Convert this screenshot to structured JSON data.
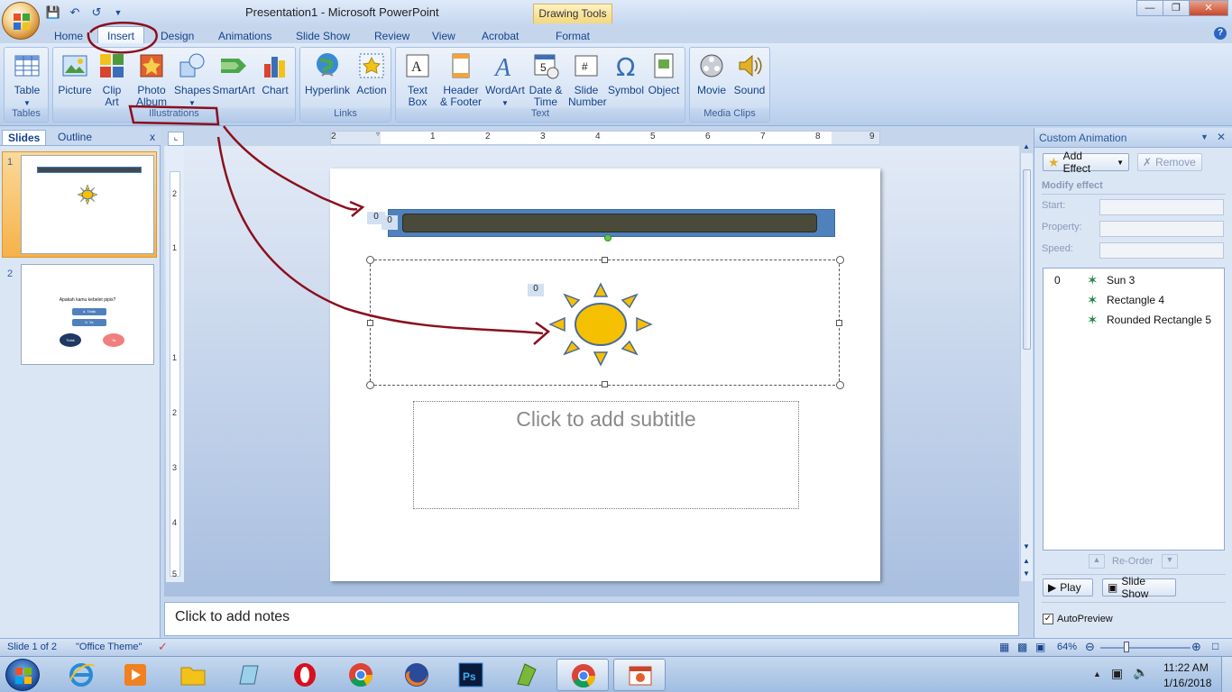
{
  "window": {
    "title": "Presentation1 - Microsoft PowerPoint",
    "contextual_tab_group": "Drawing Tools"
  },
  "ribbon_tabs": [
    "Home",
    "Insert",
    "Design",
    "Animations",
    "Slide Show",
    "Review",
    "View",
    "Acrobat",
    "Format"
  ],
  "active_tab": "Insert",
  "ribbon_groups": {
    "tables": {
      "label": "Tables",
      "buttons": [
        "Table"
      ]
    },
    "illustrations": {
      "label": "Illustrations",
      "buttons": [
        "Picture",
        "Clip Art",
        "Photo Album",
        "Shapes",
        "SmartArt",
        "Chart"
      ]
    },
    "links": {
      "label": "Links",
      "buttons": [
        "Hyperlink",
        "Action"
      ]
    },
    "text": {
      "label": "Text",
      "buttons": [
        "Text Box",
        "Header & Footer",
        "WordArt",
        "Date & Time",
        "Slide Number",
        "Symbol",
        "Object"
      ]
    },
    "media": {
      "label": "Media Clips",
      "buttons": [
        "Movie",
        "Sound"
      ]
    }
  },
  "left_pane": {
    "tabs": [
      "Slides",
      "Outline"
    ],
    "close": "x",
    "slides": [
      {
        "number": "1"
      },
      {
        "number": "2",
        "question": "Apakah kamu kebelet pipis?",
        "option_a": "a. Tidak",
        "option_b": "b. Ya",
        "oval_left": "Tidak",
        "oval_right": "Ya"
      }
    ]
  },
  "ruler": {
    "top_marks": [
      "2",
      "1",
      "1",
      "2",
      "3",
      "4",
      "5",
      "6",
      "7",
      "8",
      "9"
    ],
    "left_marks": [
      "2",
      "1",
      "1",
      "2",
      "3",
      "4",
      "5"
    ]
  },
  "slide": {
    "subtitle_placeholder": "Click to add subtitle",
    "tags": [
      "0",
      "0",
      "0"
    ]
  },
  "notes_placeholder": "Click to add notes",
  "custom_animation": {
    "title": "Custom Animation",
    "add_effect": "Add Effect",
    "remove": "Remove",
    "modify_effect": "Modify effect",
    "start_label": "Start:",
    "property_label": "Property:",
    "speed_label": "Speed:",
    "list": [
      {
        "index": "0",
        "name": "Sun 3"
      },
      {
        "index": "",
        "name": "Rectangle 4"
      },
      {
        "index": "",
        "name": "Rounded Rectangle 5"
      }
    ],
    "reorder": "Re-Order",
    "play": "Play",
    "slide_show": "Slide Show",
    "autopreview": "AutoPreview"
  },
  "status": {
    "slide_of": "Slide 1 of 2",
    "theme": "\"Office Theme\"",
    "zoom": "64%"
  },
  "taskbar": {
    "time": "11:22 AM",
    "date": "1/16/2018"
  },
  "colors": {
    "ribbon_bg": "#c8daf2",
    "slide_bar_fill": "#4a4a3a",
    "slide_bar_border": "#4a78b8",
    "sun_fill": "#f5c000",
    "annotation_red": "#8b0f1e"
  }
}
